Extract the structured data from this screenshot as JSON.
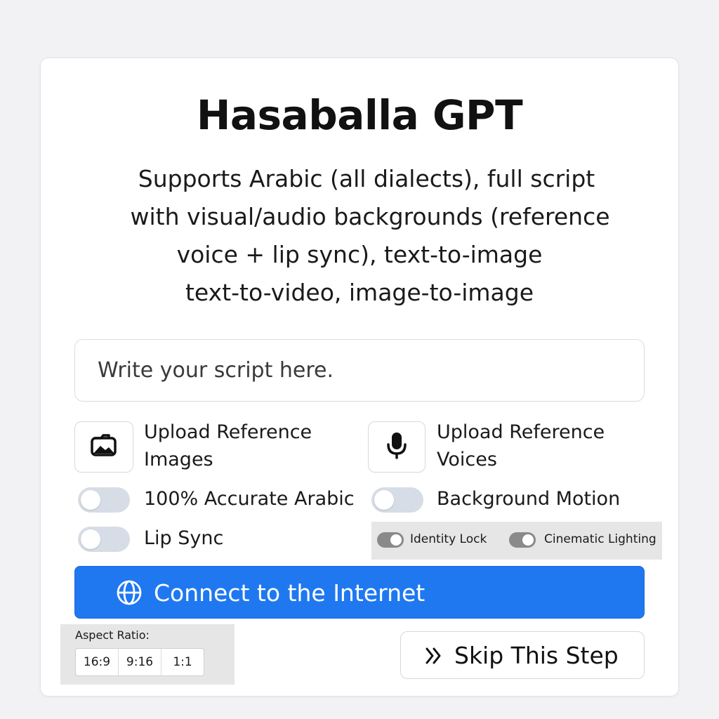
{
  "app": {
    "title": "Hasaballa GPT",
    "description_lines": [
      "Supports Arabic (all dialects), full script",
      "with visual/audio backgrounds (reference",
      "voice + lip sync), text-to-image",
      "text-to-video, image-to-image"
    ]
  },
  "script_input": {
    "placeholder": "Write your script here.",
    "value": ""
  },
  "uploads": {
    "images": {
      "label_line1": "Upload Reference",
      "label_line2": "Images",
      "icon": "image-upload-icon"
    },
    "voices": {
      "label_line1": "Upload Reference",
      "label_line2": "Voices",
      "icon": "microphone-icon"
    }
  },
  "toggles": {
    "accurate_arabic": {
      "label": "100% Accurate Arabic",
      "on": false
    },
    "background_motion": {
      "label": "Background Motion",
      "on": false
    },
    "lip_sync": {
      "label": "Lip Sync",
      "on": false
    },
    "identity_lock": {
      "label": "Identity Lock",
      "on": true
    },
    "cinematic_lighting": {
      "label": "Cinematic Lighting",
      "on": true
    }
  },
  "connect": {
    "label": "Connect to the Internet",
    "icon": "globe-icon",
    "color": "#1f78f0"
  },
  "aspect_ratio": {
    "label": "Aspect Ratio:",
    "options": [
      "16:9",
      "9:16",
      "1:1"
    ]
  },
  "skip": {
    "label": "Skip This Step",
    "icon": "double-chevron-right-icon"
  },
  "colors": {
    "background": "#f2f2f4",
    "card": "#ffffff",
    "accent": "#1f78f0",
    "toggle_off": "#d7dde6",
    "toggle_on_mini": "#8a8a8a",
    "panel_gray": "#e6e6e6"
  }
}
